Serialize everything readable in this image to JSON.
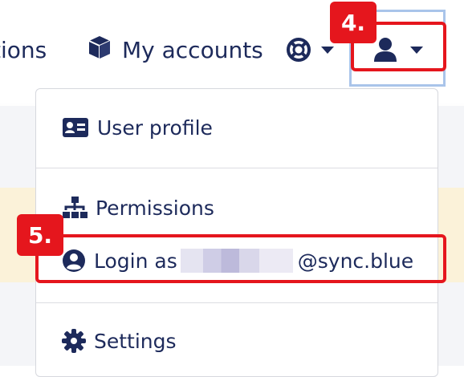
{
  "nav": {
    "operations_label": "tions",
    "accounts_label": "My accounts",
    "accounts_icon": "cube-icon",
    "help_icon": "life-ring-icon",
    "user_icon": "user-icon"
  },
  "dropdown": {
    "items": [
      {
        "label": "User profile",
        "icon": "id-card-icon"
      },
      {
        "label": "Permissions",
        "icon": "sitemap-icon"
      },
      {
        "label_prefix": "Login as",
        "label_suffix": "@sync.blue",
        "icon": "user-circle-icon"
      },
      {
        "label": "Settings",
        "icon": "gear-icon"
      }
    ]
  },
  "annotations": {
    "step_user": "4.",
    "step_login": "5."
  },
  "colors": {
    "text": "#1d2a5b",
    "highlight": "#e5161d",
    "focus_ring": "#a9c4ea",
    "alert_background": "#fbf2d9"
  }
}
